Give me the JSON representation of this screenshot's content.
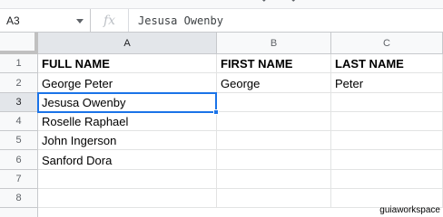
{
  "toolbar": {
    "undo_icon": "undo-icon",
    "redo_icon": "redo-icon"
  },
  "formula_bar": {
    "name_box": "A3",
    "fx_label": "fx",
    "value": "Jesusa Owenby"
  },
  "columns": [
    "A",
    "B",
    "C"
  ],
  "rows": [
    "1",
    "2",
    "3",
    "4",
    "5",
    "6",
    "7",
    "8"
  ],
  "cells": {
    "A1": "FULL NAME",
    "B1": "FIRST NAME",
    "C1": "LAST NAME",
    "A2": "George Peter",
    "B2": "George",
    "C2": "Peter",
    "A3": "Jesusa Owenby",
    "A4": "Roselle Raphael",
    "A5": "John Ingerson",
    "A6": "Sanford Dora"
  },
  "selected_cell": "A3",
  "watermark": "guiaworkspace",
  "colors": {
    "selection": "#1a73e8",
    "header_bg": "#f8f9fa",
    "active_header_bg": "#e3e6ea"
  }
}
